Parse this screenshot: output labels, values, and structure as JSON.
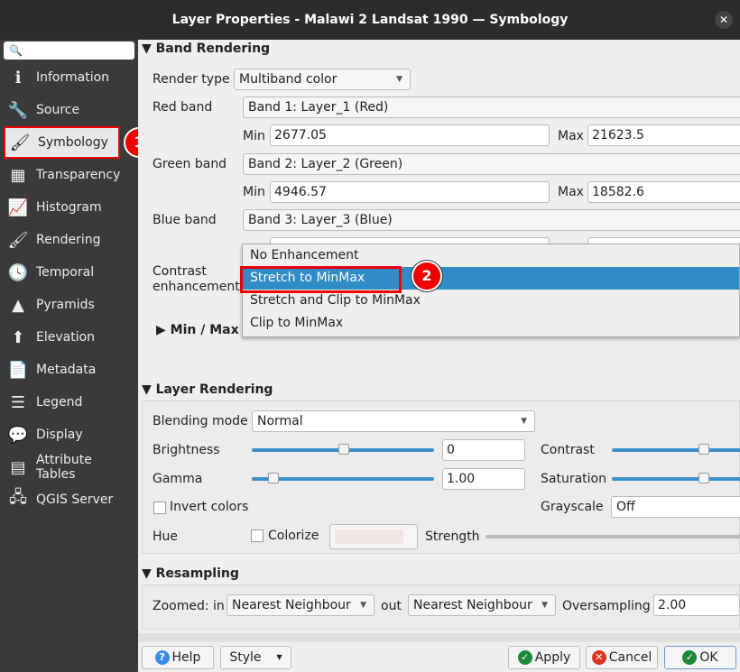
{
  "window": {
    "title": "Layer Properties - Malawi 2 Landsat 1990 — Symbology",
    "close": "✕"
  },
  "sidebar": {
    "search_icon": "🔍",
    "items": [
      {
        "label": "Information",
        "icon": "info-icon",
        "glyph": "ℹ"
      },
      {
        "label": "Source",
        "icon": "wrench-icon",
        "glyph": "🔧"
      },
      {
        "label": "Symbology",
        "icon": "paintbrush-icon",
        "glyph": "🖌"
      },
      {
        "label": "Transparency",
        "icon": "transparency-icon",
        "glyph": "▦"
      },
      {
        "label": "Histogram",
        "icon": "histogram-icon",
        "glyph": "📈"
      },
      {
        "label": "Rendering",
        "icon": "brush-icon",
        "glyph": "🖌"
      },
      {
        "label": "Temporal",
        "icon": "clock-icon",
        "glyph": "🕓"
      },
      {
        "label": "Pyramids",
        "icon": "pyramid-icon",
        "glyph": "▲"
      },
      {
        "label": "Elevation",
        "icon": "elevation-icon",
        "glyph": "⬆"
      },
      {
        "label": "Metadata",
        "icon": "metadata-icon",
        "glyph": "📄"
      },
      {
        "label": "Legend",
        "icon": "legend-icon",
        "glyph": "☰"
      },
      {
        "label": "Display",
        "icon": "speech-bubble-icon",
        "glyph": "💬"
      },
      {
        "label": "Attribute\nTables",
        "icon": "table-icon",
        "glyph": "▤"
      },
      {
        "label": "QGIS Server",
        "icon": "server-icon",
        "glyph": "🖧"
      }
    ]
  },
  "annotations": {
    "step1": "1",
    "step2": "2",
    "color": "#e00000"
  },
  "band_rendering": {
    "title": "Band Rendering",
    "render_type_label": "Render type",
    "render_type": "Multiband color",
    "red_label": "Red band",
    "red_band": "Band 1: Layer_1 (Red)",
    "red_min": "2677.05",
    "red_max": "21623.5",
    "green_label": "Green band",
    "green_band": "Band 2: Layer_2 (Green)",
    "green_min": "4946.57",
    "green_max": "18582.6",
    "blue_label": "Blue band",
    "blue_band": "Band 3: Layer_3 (Blue)",
    "min_label": "Min",
    "max_label": "Max",
    "contrast_label": "Contrast\nenhancement",
    "minmax_label": "Min / Max V",
    "options": [
      "No Enhancement",
      "Stretch to MinMax",
      "Stretch and Clip to MinMax",
      "Clip to MinMax"
    ]
  },
  "layer_rendering": {
    "title": "Layer Rendering",
    "blending_label": "Blending mode",
    "blending": "Normal",
    "brightness_label": "Brightness",
    "brightness": "0",
    "contrast_label": "Contrast",
    "gamma_label": "Gamma",
    "gamma": "1.00",
    "saturation_label": "Saturation",
    "invert_label": "Invert colors",
    "grayscale_label": "Grayscale",
    "grayscale": "Off",
    "hue_label": "Hue",
    "colorize_label": "Colorize",
    "strength_label": "Strength"
  },
  "resampling": {
    "title": "Resampling",
    "zoomed_in_label": "Zoomed: in",
    "zoomed_in": "Nearest Neighbour",
    "out_label": "out",
    "zoomed_out": "Nearest Neighbour",
    "oversampling_label": "Oversampling",
    "oversampling": "2.00"
  },
  "buttons": {
    "help": "Help",
    "style": "Style",
    "apply": "Apply",
    "cancel": "Cancel",
    "ok": "OK"
  }
}
